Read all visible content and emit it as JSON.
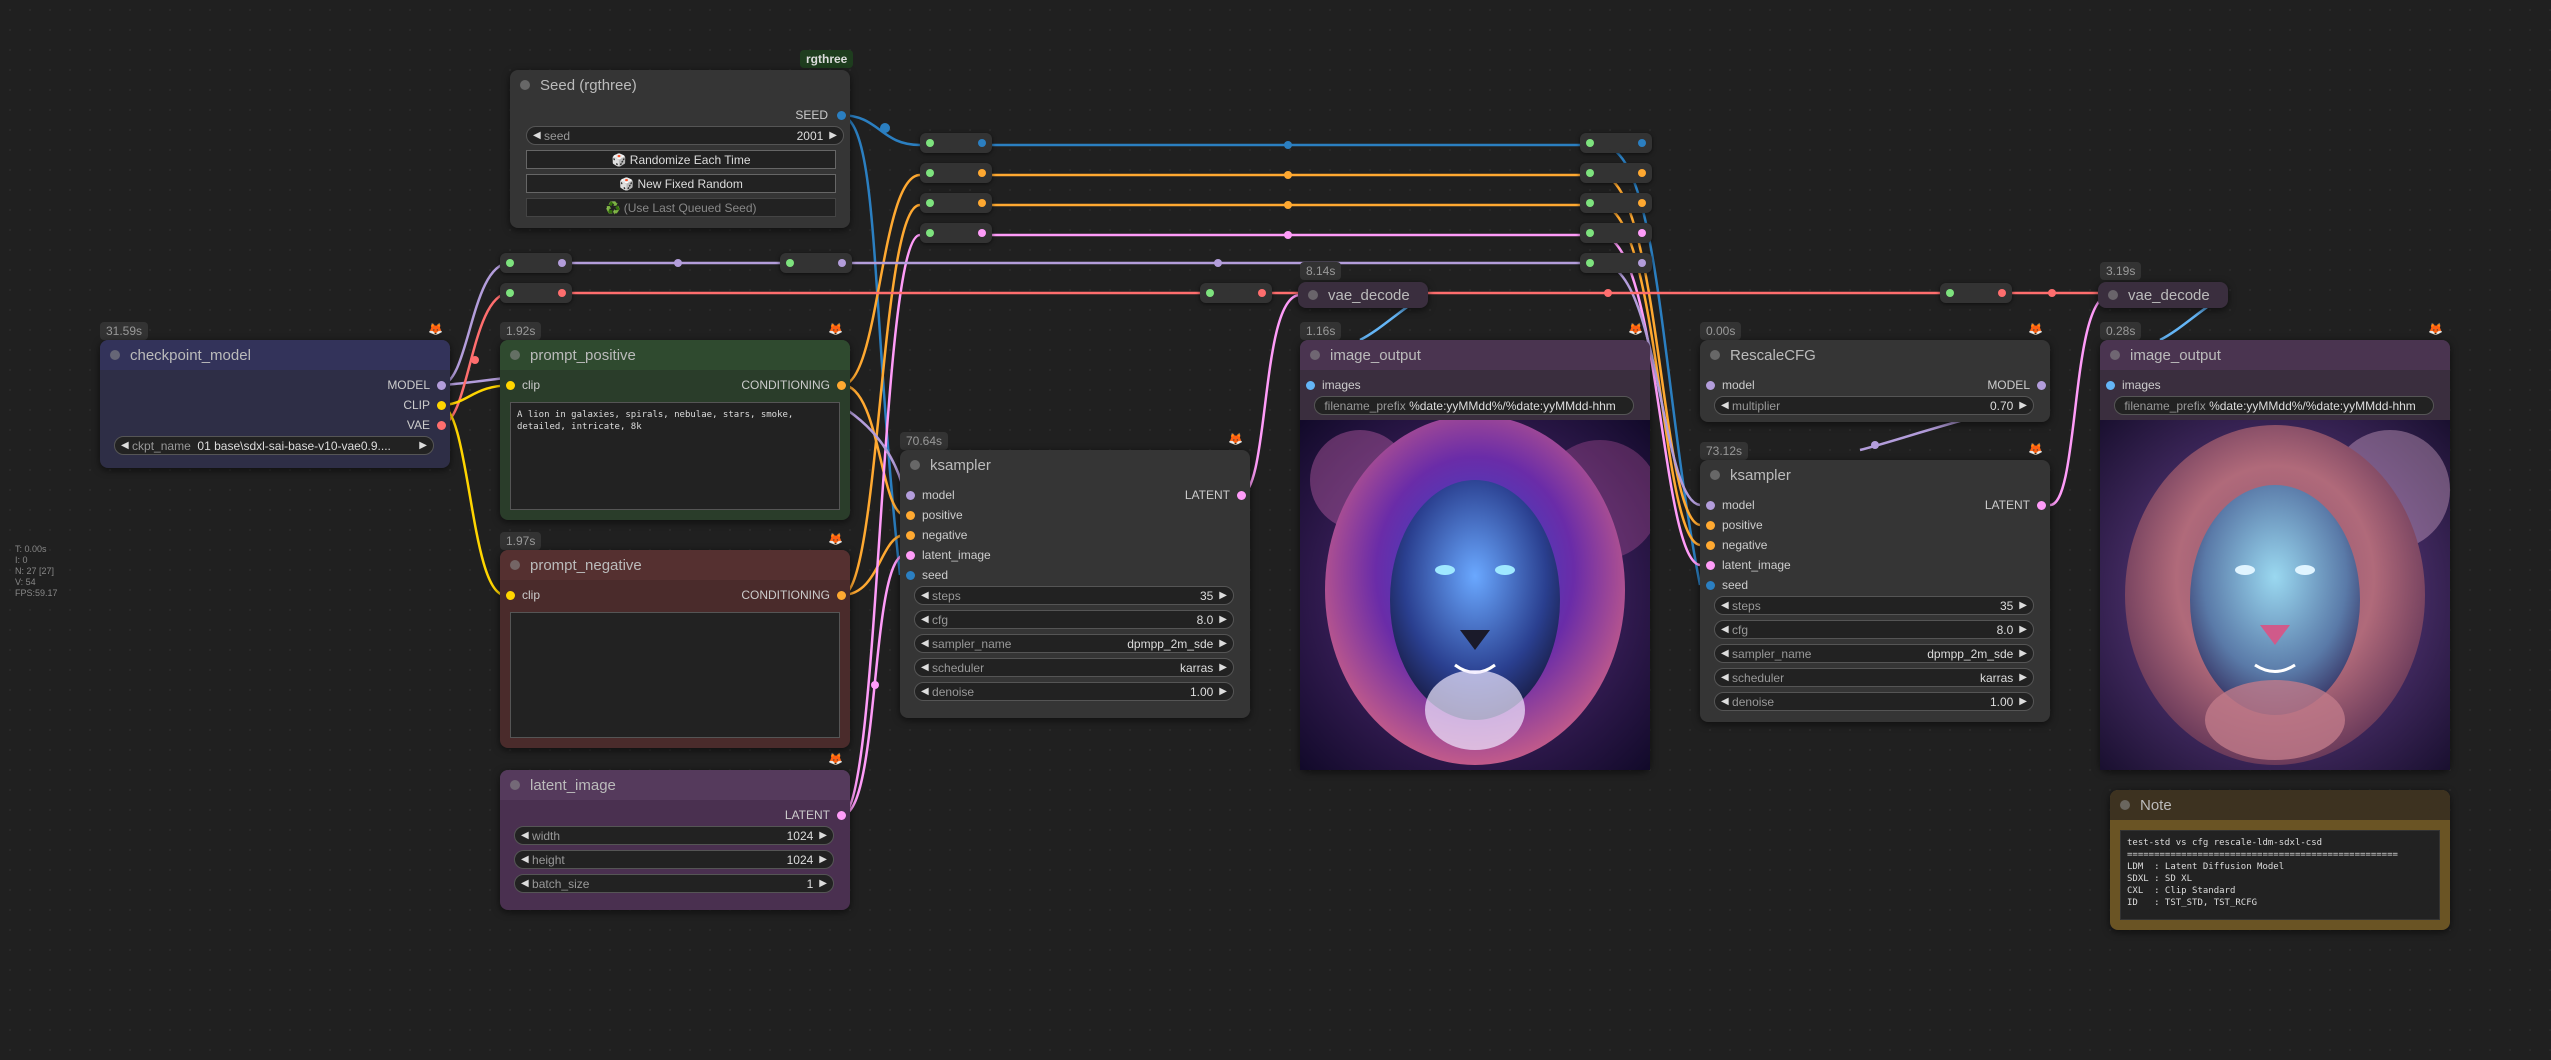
{
  "stats": [
    "T: 0.00s",
    "I: 0",
    "N: 27 [27]",
    "V: 54",
    "FPS:59.17"
  ],
  "badge_rgthree": "rgthree",
  "seed_node": {
    "title": "Seed (rgthree)",
    "out": "SEED",
    "seed_label": "seed",
    "seed_value": "2001",
    "randomize": "🎲 Randomize Each Time",
    "new_fixed": "🎲 New Fixed Random",
    "last_queued": "♻️ (Use Last Queued Seed)"
  },
  "checkpoint": {
    "time": "31.59s",
    "title": "checkpoint_model",
    "model": "MODEL",
    "clip": "CLIP",
    "vae": "VAE",
    "ckpt_label": "ckpt_name",
    "ckpt_value": "01 base\\sdxl-sai-base-v10-vae0.9...."
  },
  "prompt_positive": {
    "time": "1.92s",
    "title": "prompt_positive",
    "clip": "clip",
    "cond": "CONDITIONING",
    "text": "A lion in galaxies, spirals, nebulae, stars, smoke,\ndetailed, intricate, 8k"
  },
  "prompt_negative": {
    "time": "1.97s",
    "title": "prompt_negative",
    "clip": "clip",
    "cond": "CONDITIONING",
    "text": ""
  },
  "latent": {
    "title": "latent_image",
    "out": "LATENT",
    "width_label": "width",
    "width": "1024",
    "height_label": "height",
    "height": "1024",
    "batch_label": "batch_size",
    "batch": "1"
  },
  "ksampler1": {
    "time": "70.64s",
    "title": "ksampler",
    "inputs": [
      "model",
      "positive",
      "negative",
      "latent_image",
      "seed"
    ],
    "out": "LATENT",
    "widgets": [
      [
        "steps",
        "35"
      ],
      [
        "cfg",
        "8.0"
      ],
      [
        "sampler_name",
        "dpmpp_2m_sde"
      ],
      [
        "scheduler",
        "karras"
      ],
      [
        "denoise",
        "1.00"
      ]
    ]
  },
  "vae1": {
    "time": "8.14s",
    "title": "vae_decode"
  },
  "img1": {
    "time": "1.16s",
    "title": "image_output",
    "images": "images",
    "prefix_label": "filename_prefix",
    "prefix_value": "%date:yyMMdd%/%date:yyMMdd-hhm"
  },
  "rescale": {
    "time": "0.00s",
    "title": "RescaleCFG",
    "model": "model",
    "model_out": "MODEL",
    "mult_label": "multiplier",
    "mult": "0.70"
  },
  "ksampler2": {
    "time": "73.12s",
    "title": "ksampler",
    "inputs": [
      "model",
      "positive",
      "negative",
      "latent_image",
      "seed"
    ],
    "out": "LATENT",
    "widgets": [
      [
        "steps",
        "35"
      ],
      [
        "cfg",
        "8.0"
      ],
      [
        "sampler_name",
        "dpmpp_2m_sde"
      ],
      [
        "scheduler",
        "karras"
      ],
      [
        "denoise",
        "1.00"
      ]
    ]
  },
  "vae2": {
    "time": "3.19s",
    "title": "vae_decode"
  },
  "img2": {
    "time": "0.28s",
    "title": "image_output",
    "images": "images",
    "prefix_label": "filename_prefix",
    "prefix_value": "%date:yyMMdd%/%date:yyMMdd-hhm"
  },
  "note": {
    "title": "Note",
    "text": "test-std vs cfg rescale-ldm-sdxl-csd\n==================================================\nLDM  : Latent Diffusion Model\nSDXL : SD XL\nCXL  : Clip Standard\nID   : TST_STD, TST_RCFG"
  },
  "colors": {
    "model": "#b39ddb",
    "clip": "#ffd500",
    "vae": "#ff6e6e",
    "cond": "#ffa931",
    "latent": "#ff9cf9",
    "seed": "#2b7fc1",
    "green": "#7ee37e"
  }
}
